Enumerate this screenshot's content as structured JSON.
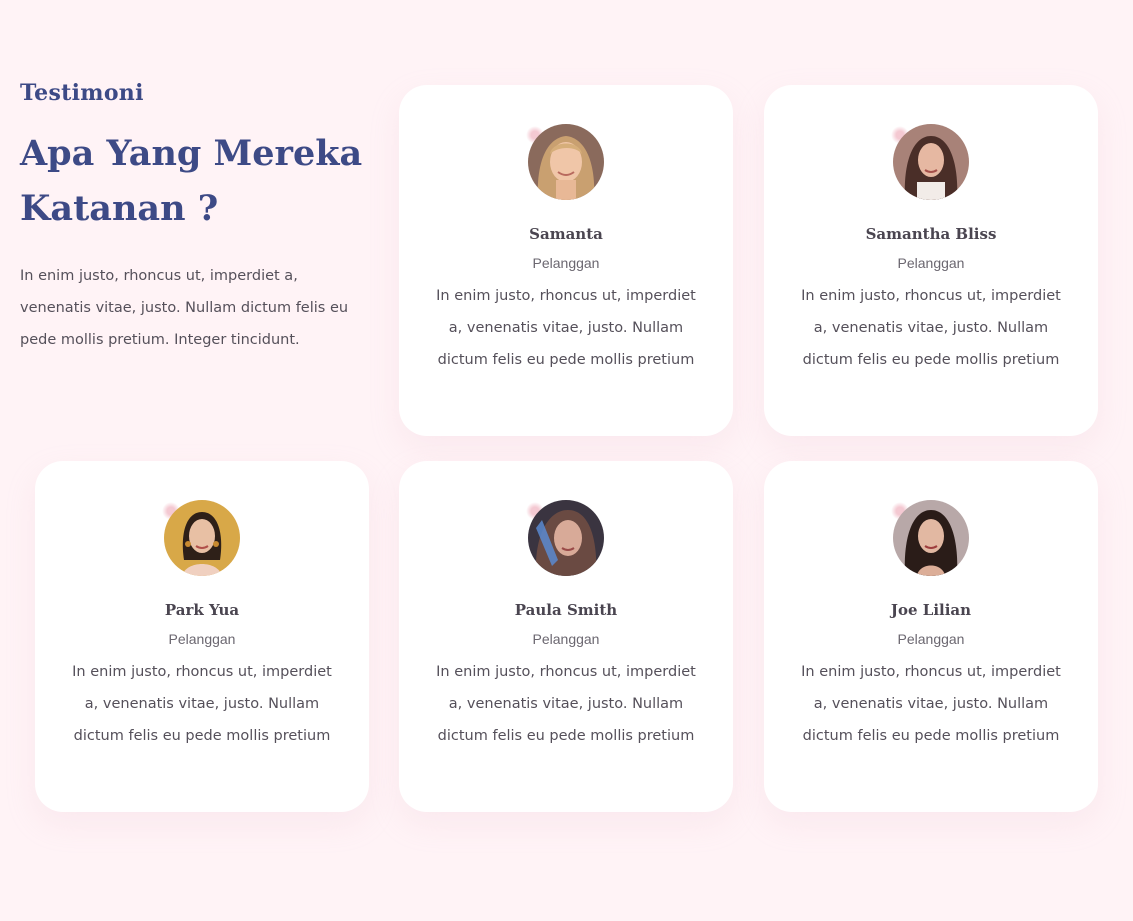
{
  "section": {
    "eyebrow": "Testimoni",
    "headline_line1": "Apa Yang Mereka",
    "headline_line2": "Katanan ?",
    "description": "In enim justo, rhoncus ut, imperdiet a, venenatis vitae, justo. Nullam dictum felis eu pede mollis pretium. Integer tincidunt."
  },
  "testimonials": [
    {
      "name": "Samanta",
      "role": "Pelanggan",
      "quote": "In enim justo, rhoncus ut, imperdiet a, venenatis vitae, justo. Nullam dictum felis eu pede mollis pretium",
      "avatar": "portrait-blonde-woman"
    },
    {
      "name": "Samantha Bliss",
      "role": "Pelanggan",
      "quote": "In enim justo, rhoncus ut, imperdiet a, venenatis vitae, justo. Nullam dictum felis eu pede mollis pretium",
      "avatar": "portrait-brunette-woman"
    },
    {
      "name": "Park Yua",
      "role": "Pelanggan",
      "quote": "In enim justo, rhoncus ut, imperdiet a, venenatis vitae, justo. Nullam dictum felis eu pede mollis pretium",
      "avatar": "portrait-woman-yellow-background"
    },
    {
      "name": "Paula Smith",
      "role": "Pelanggan",
      "quote": "In enim justo, rhoncus ut, imperdiet a, venenatis vitae, justo. Nullam dictum felis eu pede mollis pretium",
      "avatar": "portrait-woman-blue-light"
    },
    {
      "name": "Joe Lilian",
      "role": "Pelanggan",
      "quote": "In enim justo, rhoncus ut, imperdiet a, venenatis vitae, justo. Nullam dictum felis eu pede mollis pretium",
      "avatar": "portrait-dark-haired-woman"
    }
  ],
  "colors": {
    "background": "#fff3f6",
    "heading": "#3d4a86",
    "body_text": "#55505a",
    "card": "#ffffff"
  }
}
